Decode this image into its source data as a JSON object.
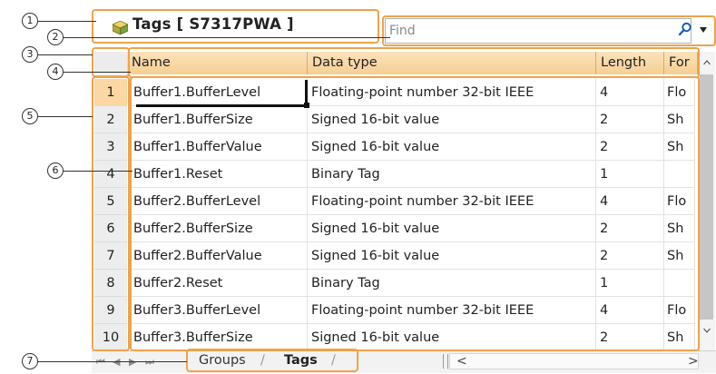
{
  "window": {
    "title": "Tags [ S7317PWA ]"
  },
  "search": {
    "placeholder": "Find"
  },
  "icons": {
    "tag_table": "tag-table-icon",
    "search": "search-icon",
    "dropdown": "chevron-down-icon"
  },
  "columns": [
    "Name",
    "Data type",
    "Length",
    "For"
  ],
  "rows": [
    {
      "num": "1",
      "name": "Buffer1.BufferLevel",
      "type": "Floating-point number 32-bit IEEE",
      "length": "4",
      "format": "Flo"
    },
    {
      "num": "2",
      "name": "Buffer1.BufferSize",
      "type": "Signed 16-bit value",
      "length": "2",
      "format": "Sh"
    },
    {
      "num": "3",
      "name": "Buffer1.BufferValue",
      "type": "Signed 16-bit value",
      "length": "2",
      "format": "Sh"
    },
    {
      "num": "4",
      "name": "Buffer1.Reset",
      "type": "Binary Tag",
      "length": "1",
      "format": ""
    },
    {
      "num": "5",
      "name": "Buffer2.BufferLevel",
      "type": "Floating-point number 32-bit IEEE",
      "length": "4",
      "format": "Flo"
    },
    {
      "num": "6",
      "name": "Buffer2.BufferSize",
      "type": "Signed 16-bit value",
      "length": "2",
      "format": "Sh"
    },
    {
      "num": "7",
      "name": "Buffer2.BufferValue",
      "type": "Signed 16-bit value",
      "length": "2",
      "format": "Sh"
    },
    {
      "num": "8",
      "name": "Buffer2.Reset",
      "type": "Binary Tag",
      "length": "1",
      "format": ""
    },
    {
      "num": "9",
      "name": "Buffer3.BufferLevel",
      "type": "Floating-point number 32-bit IEEE",
      "length": "4",
      "format": "Flo"
    },
    {
      "num": "10",
      "name": "Buffer3.BufferSize",
      "type": "Signed 16-bit value",
      "length": "2",
      "format": "Sh"
    }
  ],
  "tabs": [
    {
      "label": "Groups"
    },
    {
      "label": "Tags",
      "active": true
    }
  ],
  "callouts": [
    "1",
    "2",
    "3",
    "4",
    "5",
    "6",
    "7"
  ],
  "colors": {
    "highlight": "#f0a24a",
    "header": "#f6cf93",
    "selected_row": "#fbd7a4"
  }
}
